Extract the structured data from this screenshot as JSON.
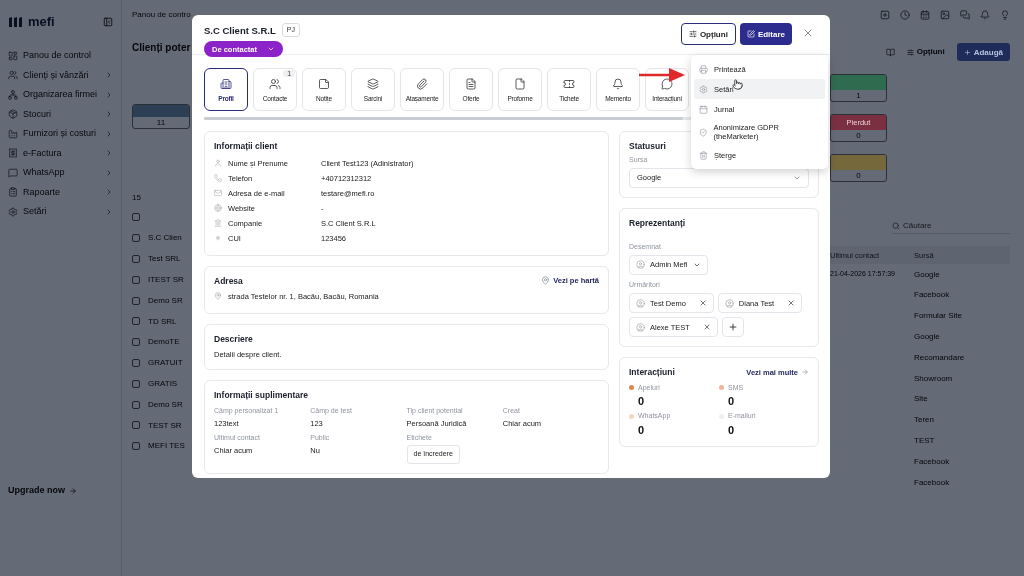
{
  "sidebar": {
    "logo": "mefi",
    "items": [
      {
        "label": "Panou de control",
        "submenu": false
      },
      {
        "label": "Clienți și vânzări",
        "submenu": true
      },
      {
        "label": "Organizarea firmei",
        "submenu": true
      },
      {
        "label": "Stocuri",
        "submenu": true
      },
      {
        "label": "Furnizori și costuri",
        "submenu": true
      },
      {
        "label": "e-Factura",
        "submenu": true
      },
      {
        "label": "WhatsApp",
        "submenu": true
      },
      {
        "label": "Rapoarte",
        "submenu": true
      },
      {
        "label": "Setări",
        "submenu": true
      }
    ],
    "upgrade": "Upgrade now"
  },
  "background": {
    "breadcrumb": "Panou de contro",
    "page_title": "Clienți poter",
    "left_stage": {
      "count": "11",
      "color": "#2d3f55"
    },
    "page_size": "15",
    "header_checked": false,
    "rows_left": [
      {
        "name": "S.C Clien",
        "checked": false
      },
      {
        "name": "Test SRL",
        "checked": false
      },
      {
        "name": "ITEST SR",
        "checked": false
      },
      {
        "name": "Demo SR",
        "checked": false
      },
      {
        "name": "TD SRL",
        "checked": false
      },
      {
        "name": "DemoTE",
        "checked": false
      },
      {
        "name": "GRATUIT",
        "checked": false
      },
      {
        "name": "GRATIS",
        "checked": false
      },
      {
        "name": "Demo SR",
        "checked": false
      },
      {
        "name": "TEST SR",
        "checked": false
      },
      {
        "name": "MEFI TES",
        "checked": false
      }
    ],
    "options": "Opțiuni",
    "add": "Adaugă",
    "stages": [
      {
        "count": "1",
        "color": "#2e6b4f"
      },
      {
        "label": "Pierdut",
        "count": "0",
        "color": "#7a3040"
      },
      {
        "count": "0",
        "color": "#75683a"
      }
    ],
    "search_placeholder": "Căutare",
    "columns": [
      "Ultimul contact",
      "Sursă"
    ],
    "rows": [
      {
        "last_contact": "21-04-2026 17:57:39",
        "source": "Google"
      },
      {
        "source": "Facebook"
      },
      {
        "source": "Formular Site"
      },
      {
        "source": "Google"
      },
      {
        "source": "Recomandare"
      },
      {
        "source": "Showroom"
      },
      {
        "source": "Site"
      },
      {
        "source": "Teren"
      },
      {
        "source": "TEST"
      },
      {
        "source": "Facebook"
      },
      {
        "source": "Facebook"
      }
    ]
  },
  "modal": {
    "title": "S.C Client S.R.L",
    "type_badge": "PJ",
    "status": "De contactat",
    "options_button": {
      "label": "Opțiuni",
      "open": true
    },
    "edit_button": "Editare",
    "tabs": [
      {
        "label": "Profil",
        "selected": true
      },
      {
        "label": "Contacte",
        "badge": "1",
        "selected": false
      },
      {
        "label": "Notițe",
        "selected": false
      },
      {
        "label": "Sarcini",
        "selected": false
      },
      {
        "label": "Atașamente",
        "selected": false
      },
      {
        "label": "Oferte",
        "selected": false
      },
      {
        "label": "Proforme",
        "selected": false
      },
      {
        "label": "Tichete",
        "selected": false
      },
      {
        "label": "Memento",
        "selected": false
      },
      {
        "label": "Interacțiuni",
        "selected": false
      }
    ],
    "menu": [
      {
        "label": "Printează",
        "highlighted": false
      },
      {
        "label": "Setări",
        "highlighted": true
      },
      {
        "label": "Jurnal",
        "highlighted": false
      },
      {
        "label": "Anonimizare GDPR (theMarketer)",
        "highlighted": false
      },
      {
        "label": "Șterge",
        "highlighted": false
      }
    ],
    "client_info": {
      "title": "Informații client",
      "rows": [
        {
          "label": "Nume și Prenume",
          "value": "Client Test123 (Adinistrator)"
        },
        {
          "label": "Telefon",
          "value": "+40712312312"
        },
        {
          "label": "Adresa de e-mail",
          "value": "testare@mefi.ro"
        },
        {
          "label": "Website",
          "value": "-"
        },
        {
          "label": "Companie",
          "value": "S.C Client S.R.L"
        },
        {
          "label": "CUI",
          "value": "123456"
        }
      ]
    },
    "address": {
      "title": "Adresa",
      "map_link": "Vezi pe hartă",
      "text": "strada Testelor nr. 1, Bacău, Bacău, Romania"
    },
    "description": {
      "title": "Descriere",
      "text": "Detalii despre client."
    },
    "extra": {
      "title": "Informații suplimentare",
      "fields": [
        {
          "label": "Câmp personalizat 1",
          "value": "123text",
          "kind": "text"
        },
        {
          "label": "Câmp de test",
          "value": "123",
          "kind": "text"
        },
        {
          "label": "Tip client potențial",
          "value": "Persoană Juridică",
          "kind": "text"
        },
        {
          "label": "Creat",
          "value": "Chiar acum",
          "kind": "text"
        },
        {
          "label": "Ultimul contact",
          "value": "Chiar acum",
          "kind": "text"
        },
        {
          "label": "Public",
          "value": "Nu",
          "kind": "text"
        },
        {
          "label": "Etichete",
          "value": "de încredere",
          "kind": "tag"
        }
      ]
    },
    "statuses": {
      "title": "Statusuri",
      "source_label": "Sursa",
      "source_value": "Google"
    },
    "representatives": {
      "title": "Reprezentanți",
      "assigned_label": "Desemnat",
      "assigned": "Admin Mefi",
      "followers_label": "Urmăritori",
      "followers": [
        "Test Demo",
        "Diana Test",
        "Alexe TEST"
      ]
    },
    "interactions": {
      "title": "Interacțiuni",
      "more_link": "Vezi mai multe",
      "items": [
        {
          "label": "Apeluri",
          "count": "0",
          "color": "#e0864a"
        },
        {
          "label": "SMS",
          "count": "0",
          "color": "#eeb49c"
        },
        {
          "label": "WhatsApp",
          "count": "0",
          "color": "#f2d8c2"
        },
        {
          "label": "E-mailuri",
          "count": "0",
          "color": "#f1eeee"
        }
      ]
    }
  }
}
